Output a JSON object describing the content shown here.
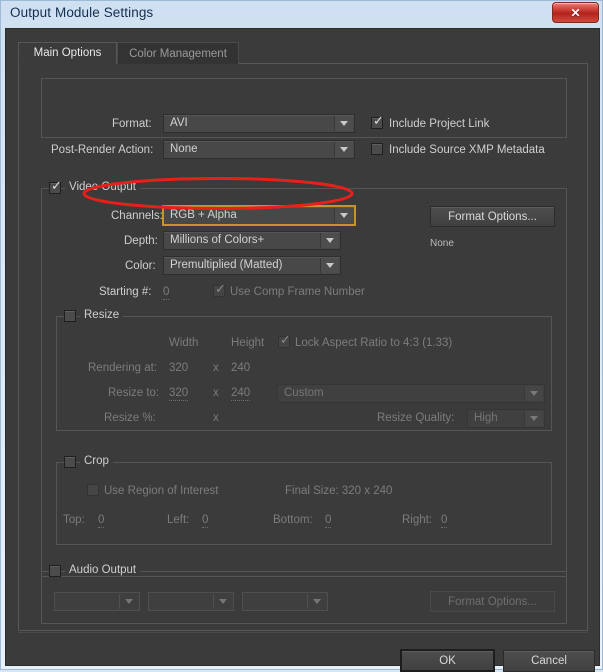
{
  "window": {
    "title": "Output Module Settings",
    "close_label": "✕",
    "close_icon": "close-icon"
  },
  "tabs": [
    {
      "label": "Main Options",
      "active": true
    },
    {
      "label": "Color Management",
      "active": false
    }
  ],
  "main_options": {
    "format": {
      "label": "Format:",
      "value": "AVI"
    },
    "post_render_action": {
      "label": "Post-Render Action:",
      "value": "None"
    },
    "include_project_link": {
      "label": "Include Project Link",
      "checked": true
    },
    "include_source_xmp_metadata": {
      "label": "Include Source XMP Metadata",
      "checked": false
    },
    "video_output": {
      "label": "Video Output",
      "checked": true,
      "channels": {
        "label": "Channels:",
        "value": "RGB + Alpha",
        "focused": true
      },
      "depth": {
        "label": "Depth:",
        "value": "Millions of Colors+"
      },
      "color": {
        "label": "Color:",
        "value": "Premultiplied (Matted)"
      },
      "starting_number": {
        "label": "Starting #:",
        "value": "0"
      },
      "use_comp_frame_number": {
        "label": "Use Comp Frame Number",
        "checked": true,
        "disabled": true
      },
      "format_options_button": "Format Options...",
      "format_options_status": "None"
    },
    "resize": {
      "label": "Resize",
      "checked": false,
      "width_header": "Width",
      "height_header": "Height",
      "lock_aspect": {
        "label": "Lock Aspect Ratio to 4:3 (1.33)",
        "checked": true
      },
      "rendering_at": {
        "label": "Rendering at:",
        "width": "320",
        "x": "x",
        "height": "240"
      },
      "resize_to": {
        "label": "Resize to:",
        "width": "320",
        "x": "x",
        "height": "240",
        "preset": "Custom"
      },
      "resize_percent": {
        "label": "Resize %:",
        "x": "x"
      },
      "resize_quality": {
        "label": "Resize Quality:",
        "value": "High"
      }
    },
    "crop": {
      "label": "Crop",
      "checked": false,
      "use_region_of_interest": {
        "label": "Use Region of Interest",
        "checked": false
      },
      "final_size": "Final Size: 320 x 240",
      "top": {
        "label": "Top:",
        "value": "0"
      },
      "left": {
        "label": "Left:",
        "value": "0"
      },
      "bottom": {
        "label": "Bottom:",
        "value": "0"
      },
      "right": {
        "label": "Right:",
        "value": "0"
      }
    },
    "audio_output": {
      "label": "Audio Output",
      "checked": false,
      "dropdown_1": "",
      "dropdown_2": "",
      "dropdown_3": "",
      "format_options_button": "Format Options..."
    }
  },
  "footer": {
    "ok": "OK",
    "cancel": "Cancel"
  },
  "annotation": {
    "type": "ellipse",
    "color": "#e8201a",
    "target": "channels-dropdown"
  },
  "colors": {
    "panel_bg": "#3b3b3b",
    "titlebar_bg": "#d9e6f2",
    "text": "#cfcfcf",
    "text_disabled": "#7c7c7c",
    "focus_ring": "#c8922c",
    "annotation_red": "#e8201a",
    "close_button_red": "#b4231c"
  }
}
